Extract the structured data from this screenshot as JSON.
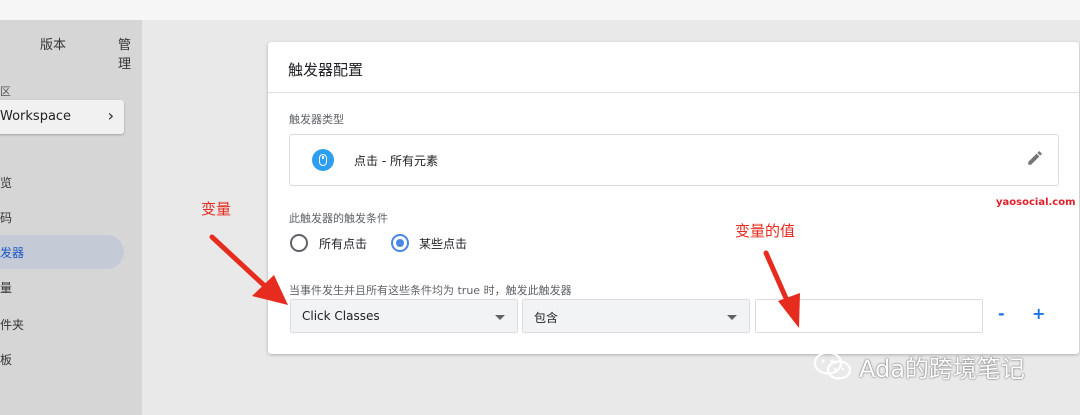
{
  "topbar": {
    "title_fragment": "",
    "name_fragment": ""
  },
  "sidebar": {
    "tabs": [
      {
        "label": "版本"
      },
      {
        "label": "管理"
      }
    ],
    "section_label": "区",
    "workspace": {
      "label": "Workspace",
      "chevron": "chevron-right-icon"
    },
    "nav": [
      {
        "label": "览"
      },
      {
        "label": "码"
      },
      {
        "label": "发器"
      },
      {
        "label": "量"
      },
      {
        "label": "件夹"
      },
      {
        "label": "板"
      }
    ],
    "active_index": 2
  },
  "card": {
    "title": "触发器配置",
    "type_label": "触发器类型",
    "type_value": "点击 - 所有元素",
    "watermark": "yaosocial.com",
    "conditions_label": "此触发器的触发条件",
    "radio_options": [
      {
        "label": "所有点击",
        "checked": false
      },
      {
        "label": "某些点击",
        "checked": true
      }
    ],
    "rule_label": "当事件发生并且所有这些条件均为 true 时，触发此触发器",
    "variable_select": "Click Classes",
    "operator_select": "包含",
    "value_input": "",
    "minus": "-",
    "plus": "+"
  },
  "annotations": {
    "variable": "变量",
    "value": "变量的值"
  },
  "brand": {
    "text": "Ada的跨境笔记"
  },
  "colors": {
    "accent": "#4a86e8",
    "annotation_red": "#e62c1e",
    "icon_blue": "#2e9ef0",
    "link_blue": "#1a73e8"
  }
}
